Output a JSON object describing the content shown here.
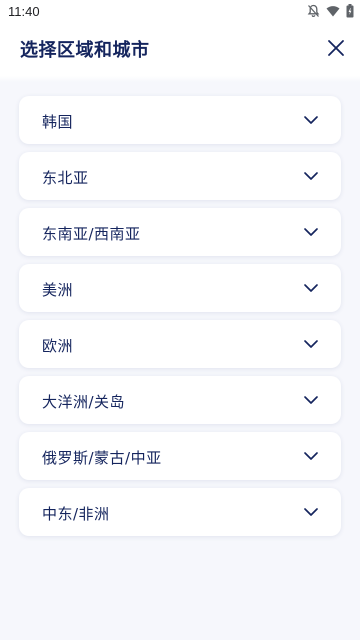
{
  "status_bar": {
    "time": "11:40",
    "icons": [
      "notifications-off-icon",
      "wifi-icon",
      "battery-icon"
    ]
  },
  "header": {
    "title": "选择区域和城市",
    "close_icon": "close-icon"
  },
  "regions": [
    {
      "label": "韩国"
    },
    {
      "label": "东北亚"
    },
    {
      "label": "东南亚/西南亚"
    },
    {
      "label": "美洲"
    },
    {
      "label": "欧洲"
    },
    {
      "label": "大洋洲/关岛"
    },
    {
      "label": "俄罗斯/蒙古/中亚"
    },
    {
      "label": "中东/非洲"
    }
  ],
  "colors": {
    "primary_text": "#15255e",
    "background": "#f6f7fc",
    "card": "#ffffff"
  }
}
